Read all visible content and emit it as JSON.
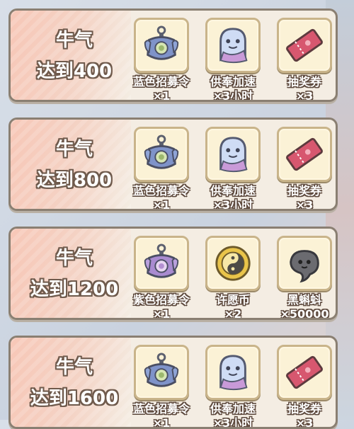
{
  "cards": [
    {
      "milestone": {
        "line1": "牛气",
        "line2": "达到400"
      },
      "items": [
        {
          "name": "蓝色招募令",
          "qty": "×1",
          "icon": "blue-recruit-token-icon"
        },
        {
          "name": "供奉加速",
          "qty": "×3小时",
          "icon": "ghost-speedup-icon"
        },
        {
          "name": "抽奖券",
          "qty": "×3",
          "icon": "lottery-ticket-icon"
        }
      ]
    },
    {
      "milestone": {
        "line1": "牛气",
        "line2": "达到800"
      },
      "items": [
        {
          "name": "蓝色招募令",
          "qty": "×1",
          "icon": "blue-recruit-token-icon"
        },
        {
          "name": "供奉加速",
          "qty": "×3小时",
          "icon": "ghost-speedup-icon"
        },
        {
          "name": "抽奖券",
          "qty": "×3",
          "icon": "lottery-ticket-icon"
        }
      ]
    },
    {
      "milestone": {
        "line1": "牛气",
        "line2": "达到1200"
      },
      "items": [
        {
          "name": "紫色招募令",
          "qty": "×1",
          "icon": "purple-recruit-token-icon"
        },
        {
          "name": "许愿币",
          "qty": "×2",
          "icon": "wish-coin-icon"
        },
        {
          "name": "黑蝌蚪",
          "qty": "×50000",
          "icon": "black-tadpole-icon"
        }
      ]
    },
    {
      "milestone": {
        "line1": "牛气",
        "line2": "达到1600"
      },
      "items": [
        {
          "name": "蓝色招募令",
          "qty": "×1",
          "icon": "blue-recruit-token-icon"
        },
        {
          "name": "供奉加速",
          "qty": "×3小时",
          "icon": "ghost-speedup-icon"
        },
        {
          "name": "抽奖券",
          "qty": "×3",
          "icon": "lottery-ticket-icon"
        }
      ]
    }
  ],
  "colors": {
    "card_bg": "#f4ede3",
    "card_border": "#8a7f72",
    "milestone_bg": "#f7c7b7",
    "slot_bg": "#fbf2d6",
    "text_outline": "#5e4a3e"
  }
}
